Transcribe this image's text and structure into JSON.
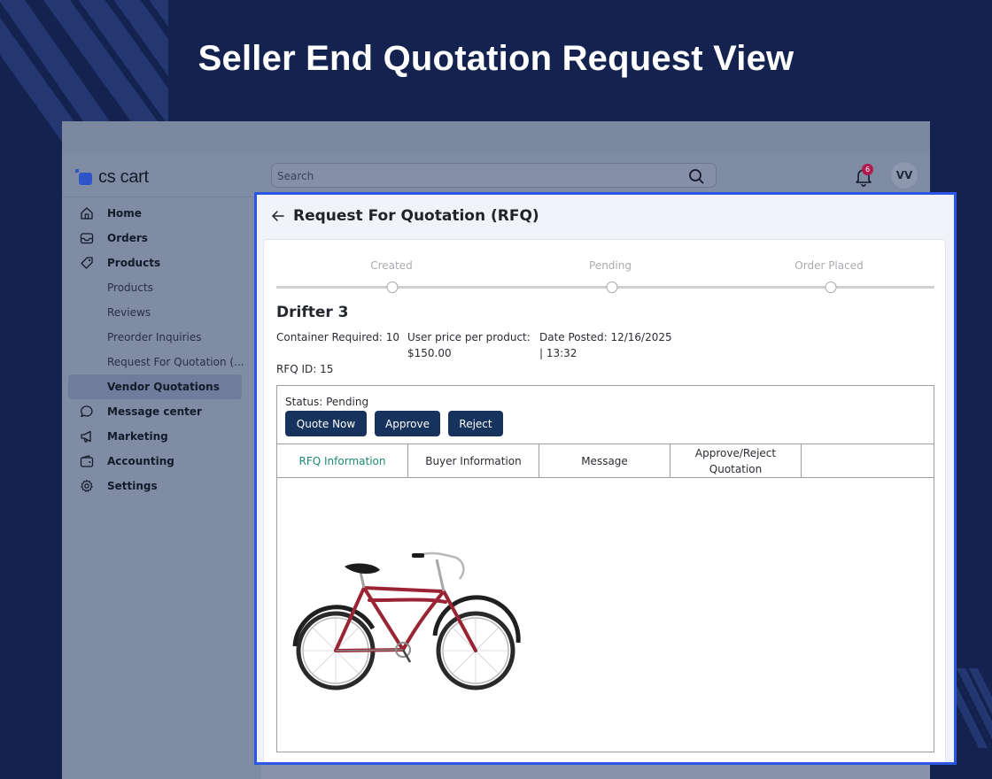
{
  "hero": {
    "title": "Seller End Quotation Request View"
  },
  "app": {
    "logo_text": "cs cart",
    "brand_color": "#2d55c9",
    "search": {
      "placeholder": "Search",
      "value": ""
    },
    "notifications": {
      "count": "6"
    },
    "user_initials": "VV",
    "sidebar": {
      "items": [
        {
          "label": "Home",
          "icon": "home-icon"
        },
        {
          "label": "Orders",
          "icon": "inbox-icon"
        },
        {
          "label": "Products",
          "icon": "tag-icon"
        },
        {
          "label": "Products",
          "sub": true
        },
        {
          "label": "Reviews",
          "sub": true
        },
        {
          "label": "Preorder Inquiries",
          "sub": true
        },
        {
          "label": "Request For Quotation (...",
          "sub": true
        },
        {
          "label": "Vendor Quotations",
          "active": true
        },
        {
          "label": "Message center",
          "icon": "chat-icon"
        },
        {
          "label": "Marketing",
          "icon": "megaphone-icon"
        },
        {
          "label": "Accounting",
          "icon": "wallet-icon"
        },
        {
          "label": "Settings",
          "icon": "gear-icon"
        }
      ]
    }
  },
  "rfq": {
    "title": "Request For Quotation (RFQ)",
    "steps": [
      "Created",
      "Pending",
      "Order Placed"
    ],
    "product_name": "Drifter 3",
    "container_required": "Container Required: 10",
    "user_price_label": "User price per product:",
    "user_price_value": "$150.00",
    "date_posted_line1": "Date Posted: 12/16/2025",
    "date_posted_line2": "| 13:32",
    "rfq_id": "RFQ ID: 15",
    "status": "Status: Pending",
    "buttons": {
      "quote_now": "Quote Now",
      "approve": "Approve",
      "reject": "Reject"
    },
    "button_color": "#16335e",
    "tabs": [
      "RFQ Information",
      "Buyer Information",
      "Message",
      "Approve/Reject Quotation"
    ],
    "active_tab_color": "#1d8a73"
  }
}
